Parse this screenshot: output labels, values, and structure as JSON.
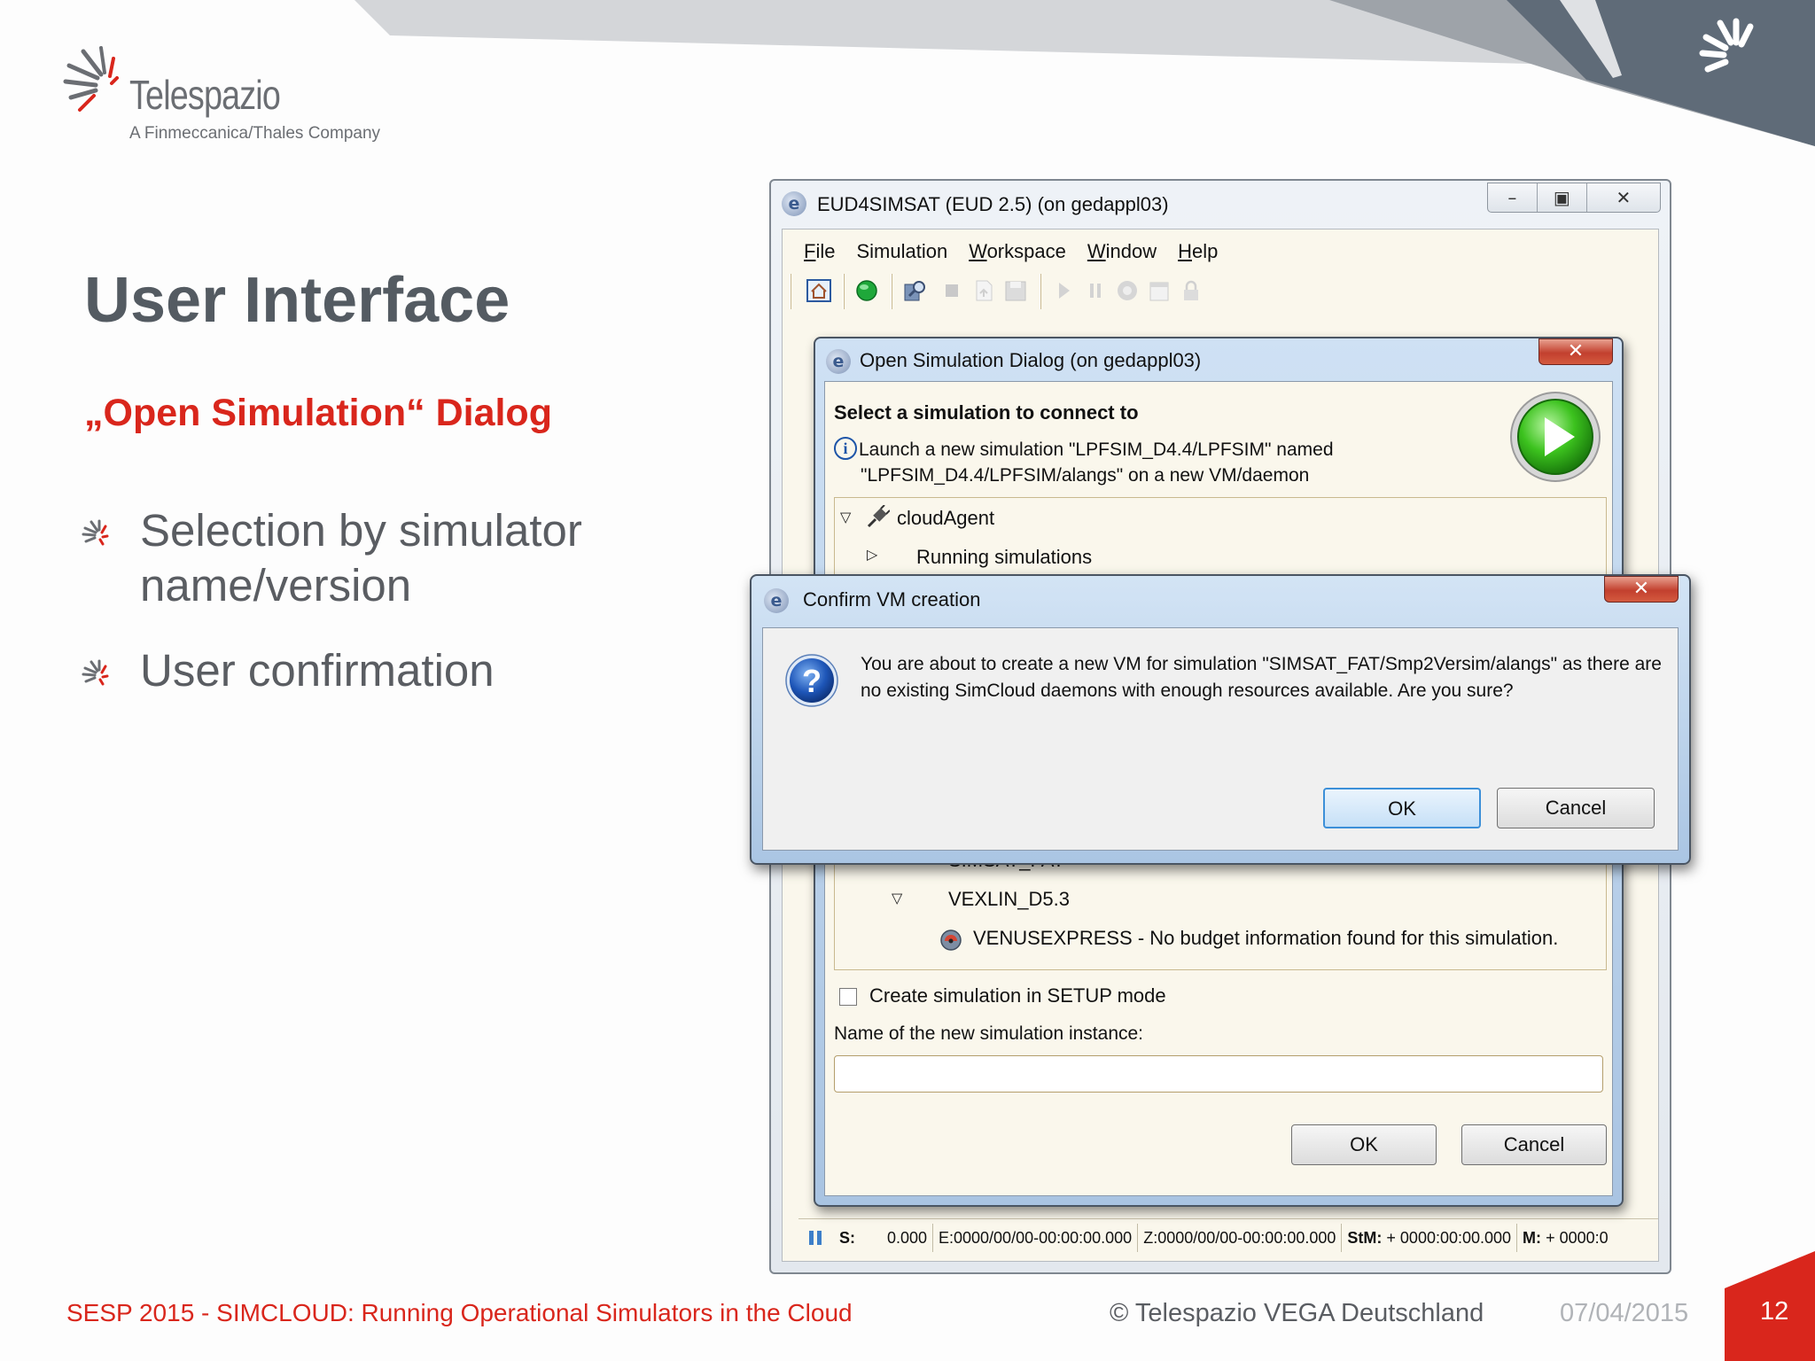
{
  "brand": {
    "name": "Telespazio",
    "tagline": "A Finmeccanica/Thales Company"
  },
  "slide": {
    "title": "User Interface",
    "subtitle": "„Open Simulation“ Dialog",
    "bullets": [
      "Selection by simulator name/version",
      "User confirmation"
    ]
  },
  "footer": {
    "event": "SESP 2015 - SIMCLOUD: Running Operational Simulators in the Cloud",
    "copyright": "© Telespazio VEGA Deutschland",
    "date": "07/04/2015",
    "page": "12"
  },
  "main_window": {
    "title": "EUD4SIMSAT (EUD 2.5)  (on gedappl03)",
    "menu": [
      {
        "first": "F",
        "rest": "ile"
      },
      {
        "first": "",
        "rest": "Simulation"
      },
      {
        "first": "W",
        "rest": "orkspace"
      },
      {
        "first": "W",
        "rest": "indow"
      },
      {
        "first": "H",
        "rest": "elp"
      }
    ],
    "statusbar": {
      "s_label": "S:",
      "s_value": "0.000",
      "e_value": "E:0000/00/00-00:00:00.000",
      "z_value": "Z:0000/00/00-00:00:00.000",
      "stm_label": "StM:",
      "stm_value": "+ 0000:00:00.000",
      "m_label": "M:",
      "m_value": "+ 0000:0"
    }
  },
  "open_dialog": {
    "title": "Open Simulation Dialog  (on gedappl03)",
    "heading": "Select a simulation to connect to",
    "message_line1": "Launch a new simulation \"LPFSIM_D4.4/LPFSIM\" named",
    "message_line2": "\"LPFSIM_D4.4/LPFSIM/alangs\" on a new VM/daemon",
    "tree": {
      "root": "cloudAgent",
      "running": "Running simulations",
      "partial": "SIMSAT_FAT",
      "vexlin": "VEXLIN_D5.3",
      "venus": "VENUSEXPRESS - No budget information found for this simulation."
    },
    "setup_checkbox_label": "Create simulation in SETUP mode",
    "setup_checked": false,
    "name_label": "Name of the new simulation instance:",
    "name_value": "",
    "ok": "OK",
    "cancel": "Cancel"
  },
  "confirm_dialog": {
    "title": "Confirm VM creation",
    "message": "You are about to create a new VM for simulation \"SIMSAT_FAT/Smp2Versim/alangs\" as there are no existing SimCloud daemons with enough resources available. Are you sure?",
    "ok": "OK",
    "cancel": "Cancel"
  },
  "colors": {
    "accent_red": "#d9261c",
    "title_gray": "#545b62",
    "dialog_bg": "#faf7ec"
  }
}
